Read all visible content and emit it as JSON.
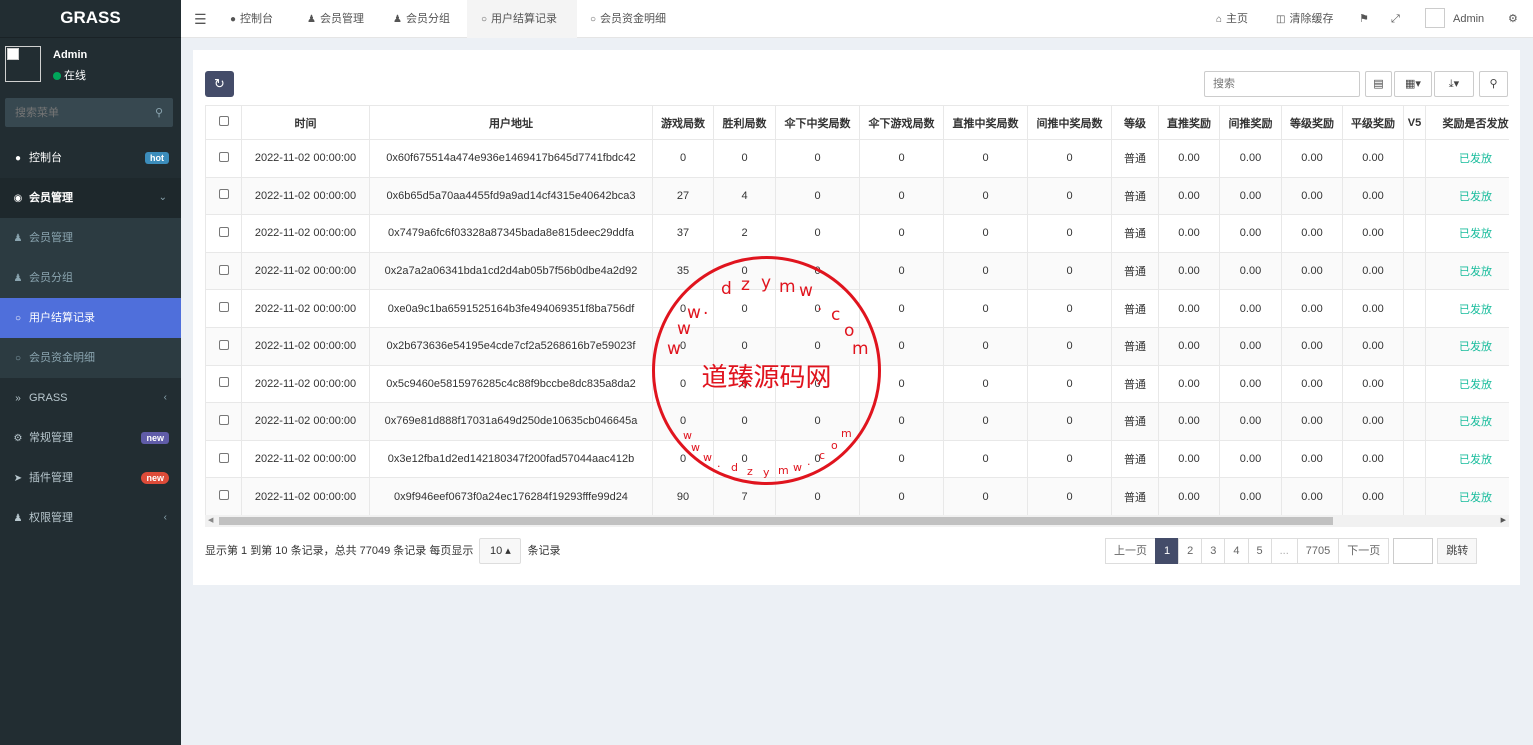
{
  "sidebar": {
    "logo": "GRASS",
    "user_name": "Admin",
    "user_status": "在线",
    "search_placeholder": "搜索菜单",
    "menu": [
      {
        "label": "控制台",
        "badge": "hot"
      },
      {
        "label": "会员管理"
      },
      {
        "label": "会员管理"
      },
      {
        "label": "会员分组"
      },
      {
        "label": "用户结算记录"
      },
      {
        "label": "会员资金明细"
      },
      {
        "label": "GRASS"
      },
      {
        "label": "常规管理",
        "badge": "new"
      },
      {
        "label": "插件管理",
        "badge": "new"
      },
      {
        "label": "权限管理"
      }
    ]
  },
  "topbar": {
    "tabs": [
      "控制台",
      "会员管理",
      "会员分组",
      "用户结算记录",
      "会员资金明细"
    ],
    "home": "主页",
    "clear_cache": "清除缓存",
    "admin": "Admin"
  },
  "toolbar": {
    "search_placeholder": "搜索"
  },
  "table": {
    "headers": [
      "时间",
      "用户地址",
      "游戏局数",
      "胜利局数",
      "伞下中奖局数",
      "伞下游戏局数",
      "直推中奖局数",
      "间推中奖局数",
      "等级",
      "直推奖励",
      "间推奖励",
      "等级奖励",
      "平级奖励",
      "V5",
      "奖励是否发放"
    ],
    "rows": [
      [
        "2022-11-02 00:00:00",
        "0x60f675514a474e936e1469417b645d7741fbdc42",
        "0",
        "0",
        "0",
        "0",
        "0",
        "0",
        "普通",
        "0.00",
        "0.00",
        "0.00",
        "0.00",
        "",
        "已发放"
      ],
      [
        "2022-11-02 00:00:00",
        "0x6b65d5a70aa4455fd9a9ad14cf4315e40642bca3",
        "27",
        "4",
        "0",
        "0",
        "0",
        "0",
        "普通",
        "0.00",
        "0.00",
        "0.00",
        "0.00",
        "",
        "已发放"
      ],
      [
        "2022-11-02 00:00:00",
        "0x7479a6fc6f03328a87345bada8e815deec29ddfa",
        "37",
        "2",
        "0",
        "0",
        "0",
        "0",
        "普通",
        "0.00",
        "0.00",
        "0.00",
        "0.00",
        "",
        "已发放"
      ],
      [
        "2022-11-02 00:00:00",
        "0x2a7a2a06341bda1cd2d4ab05b7f56b0dbe4a2d92",
        "35",
        "0",
        "0",
        "0",
        "0",
        "0",
        "普通",
        "0.00",
        "0.00",
        "0.00",
        "0.00",
        "",
        "已发放"
      ],
      [
        "2022-11-02 00:00:00",
        "0xe0a9c1ba6591525164b3fe494069351f8ba756df",
        "0",
        "0",
        "0",
        "0",
        "0",
        "0",
        "普通",
        "0.00",
        "0.00",
        "0.00",
        "0.00",
        "",
        "已发放"
      ],
      [
        "2022-11-02 00:00:00",
        "0x2b673636e54195e4cde7cf2a5268616b7e59023f",
        "0",
        "0",
        "0",
        "0",
        "0",
        "0",
        "普通",
        "0.00",
        "0.00",
        "0.00",
        "0.00",
        "",
        "已发放"
      ],
      [
        "2022-11-02 00:00:00",
        "0x5c9460e5815976285c4c88f9bccbe8dc835a8da2",
        "0",
        "0",
        "0",
        "0",
        "0",
        "0",
        "普通",
        "0.00",
        "0.00",
        "0.00",
        "0.00",
        "",
        "已发放"
      ],
      [
        "2022-11-02 00:00:00",
        "0x769e81d888f17031a649d250de10635cb046645a",
        "0",
        "0",
        "0",
        "0",
        "0",
        "0",
        "普通",
        "0.00",
        "0.00",
        "0.00",
        "0.00",
        "",
        "已发放"
      ],
      [
        "2022-11-02 00:00:00",
        "0x3e12fba1d2ed142180347f200fad57044aac412b",
        "0",
        "0",
        "0",
        "0",
        "0",
        "0",
        "普通",
        "0.00",
        "0.00",
        "0.00",
        "0.00",
        "",
        "已发放"
      ],
      [
        "2022-11-02 00:00:00",
        "0x9f946eef0673f0a24ec176284f19293fffe99d24",
        "90",
        "7",
        "0",
        "0",
        "0",
        "0",
        "普通",
        "0.00",
        "0.00",
        "0.00",
        "0.00",
        "",
        "已发放"
      ]
    ]
  },
  "pagination": {
    "info_prefix": "显示第 1 到第 10 条记录，总共 77049 条记录 每页显示",
    "page_size": "10",
    "info_suffix": "条记录",
    "prev": "上一页",
    "pages": [
      "1",
      "2",
      "3",
      "4",
      "5",
      "...",
      "7705"
    ],
    "next": "下一页",
    "jump": "跳转"
  },
  "watermark": {
    "text": "道臻源码网",
    "domain_chars": [
      "w",
      "w",
      "w",
      ".",
      "d",
      "z",
      "y",
      "m",
      "w",
      ".",
      "c",
      "o",
      "m"
    ]
  }
}
